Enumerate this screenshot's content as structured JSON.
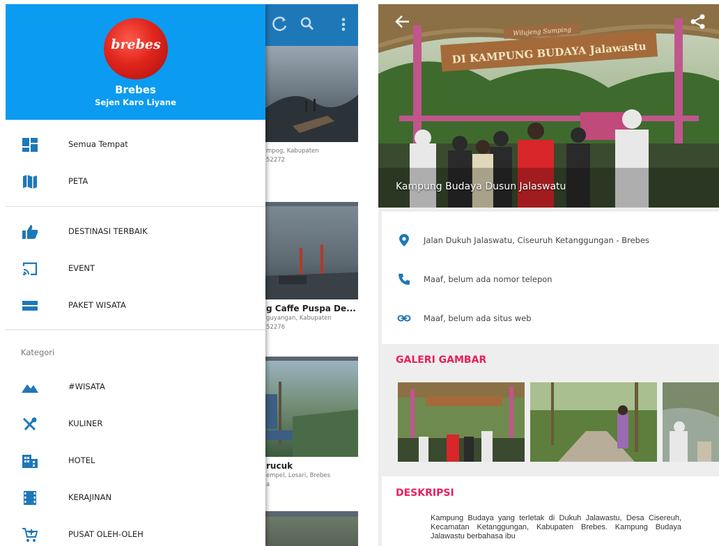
{
  "drawer": {
    "brand_name": "Brebes",
    "tagline": "Sejen Karo Liyane",
    "logo_text": "brebes",
    "main_items": [
      {
        "label": "Semua Tempat",
        "icon": "dashboard-icon"
      },
      {
        "label": "PETA",
        "icon": "map-icon"
      }
    ],
    "secondary_items": [
      {
        "label": "DESTINASI TERBAIK",
        "icon": "thumbs-up-icon"
      },
      {
        "label": "EVENT",
        "icon": "cast-icon"
      },
      {
        "label": "PAKET WISATA",
        "icon": "package-icon"
      }
    ],
    "section_label": "Kategori",
    "category_items": [
      {
        "label": "#WISATA",
        "icon": "landscape-icon"
      },
      {
        "label": "KULINER",
        "icon": "utensils-icon"
      },
      {
        "label": "HOTEL",
        "icon": "building-icon"
      },
      {
        "label": "KERAJINAN",
        "icon": "film-icon"
      },
      {
        "label": "PUSAT OLEH-OLEH",
        "icon": "shopping-cart-icon"
      }
    ],
    "accent_color": "#0b9bf0",
    "icon_color": "#1e78b8"
  },
  "feed": {
    "cards": [
      {
        "title": "",
        "address_line1": "mpog, Kabupaten",
        "address_line2": "52272"
      },
      {
        "title": "g Caffe Puspa De...",
        "address_line1": "guyangan, Kabupaten",
        "address_line2": "52276"
      },
      {
        "title": "rucuk",
        "address_line1": "empel, Losari, Brebes",
        "address_line2": "a"
      }
    ]
  },
  "detail": {
    "hero_title": "Kampung Budaya Dusun Jalaswatu",
    "hero_sign_top": "Wilujeng Sumping",
    "hero_sign_main": "DI KAMPUNG BUDAYA Jalawastu",
    "address": "Jalan Dukuh Jalaswatu, Ciseuruh Ketanggungan - Brebes",
    "phone": "Maaf, belum ada nomor telepon",
    "website": "Maaf, belum ada situs web",
    "gallery_title": "GALERI GAMBAR",
    "description_title": "DESKRIPSI",
    "description_text": "Kampung Budaya yang terletak di Dukuh Jalawastu, Desa Cisereuh, Kecamatan Ketanggungan, Kabupaten Brebes. Kampung Budaya Jalawastu berbahasa ibu",
    "accent_color": "#e8205a"
  }
}
